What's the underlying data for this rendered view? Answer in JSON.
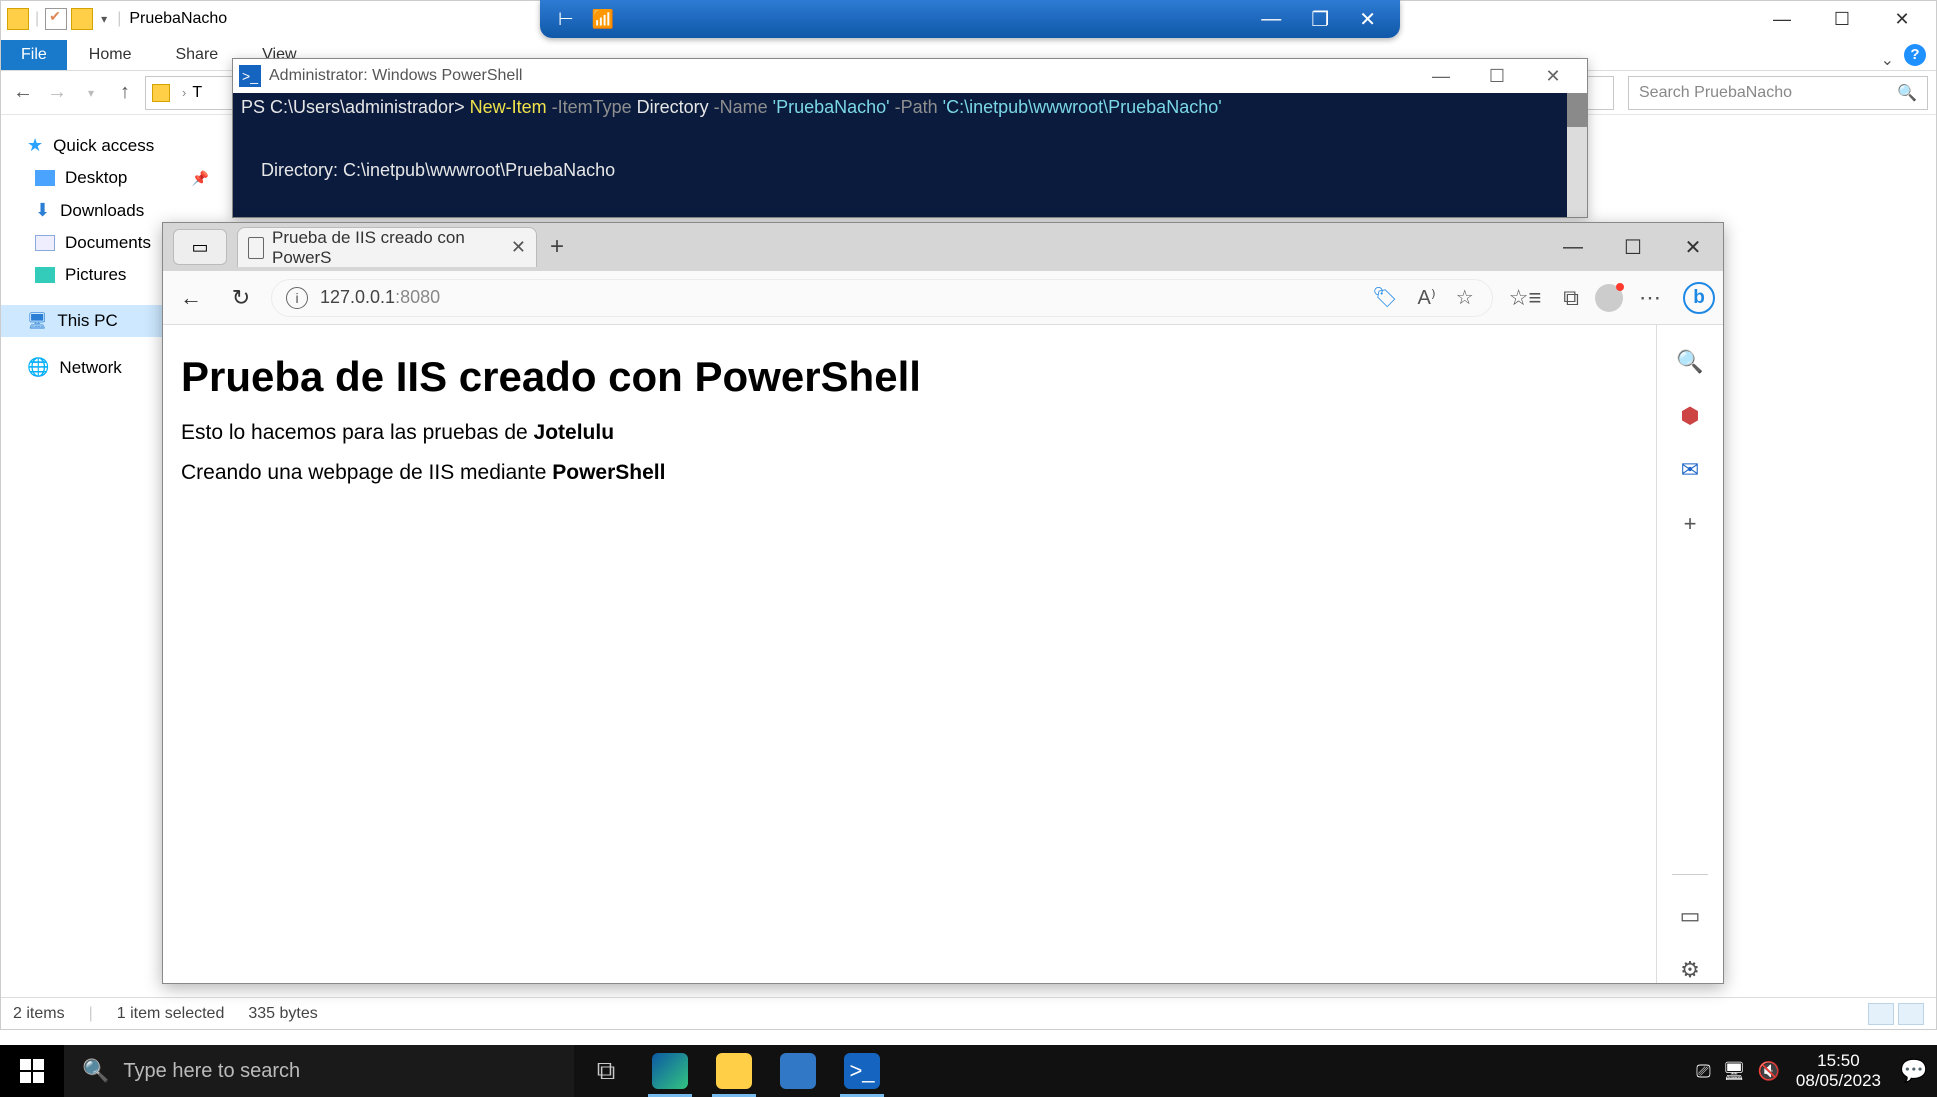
{
  "explorer": {
    "title": "PruebaNacho",
    "ribbon": {
      "file": "File",
      "home": "Home",
      "share": "Share",
      "view": "View"
    },
    "address_first": "T",
    "search_placeholder": "Search PruebaNacho",
    "side": {
      "quick_access": "Quick access",
      "desktop": "Desktop",
      "downloads": "Downloads",
      "documents": "Documents",
      "pictures": "Pictures",
      "this_pc": "This PC",
      "network": "Network"
    },
    "status": {
      "items": "2 items",
      "selected": "1 item selected",
      "size": "335 bytes"
    }
  },
  "powershell": {
    "title": "Administrator: Windows PowerShell",
    "line1_prompt": "PS C:\\Users\\administrador> ",
    "line1_cmd": "New-Item",
    "line1_p1": " -ItemType ",
    "line1_v1": "Directory",
    "line1_p2": " -Name ",
    "line1_v2": "'PruebaNacho'",
    "line1_p3": " -Path ",
    "line1_v3": "'C:\\inetpub\\wwwroot\\PruebaNacho'",
    "line3": "    Directory: C:\\inetpub\\wwwroot\\PruebaNacho"
  },
  "edge": {
    "tab_title": "Prueba de IIS creado con PowerS",
    "url_host": "127.0.0.1",
    "url_port": ":8080",
    "page": {
      "h1": "Prueba de IIS creado con PowerShell",
      "p1a": "Esto lo hacemos para las pruebas de ",
      "p1b": "Jotelulu",
      "p2a": "Creando una webpage de IIS mediante ",
      "p2b": "PowerShell"
    }
  },
  "taskbar": {
    "search": "Type here to search",
    "time": "15:50",
    "date": "08/05/2023"
  }
}
